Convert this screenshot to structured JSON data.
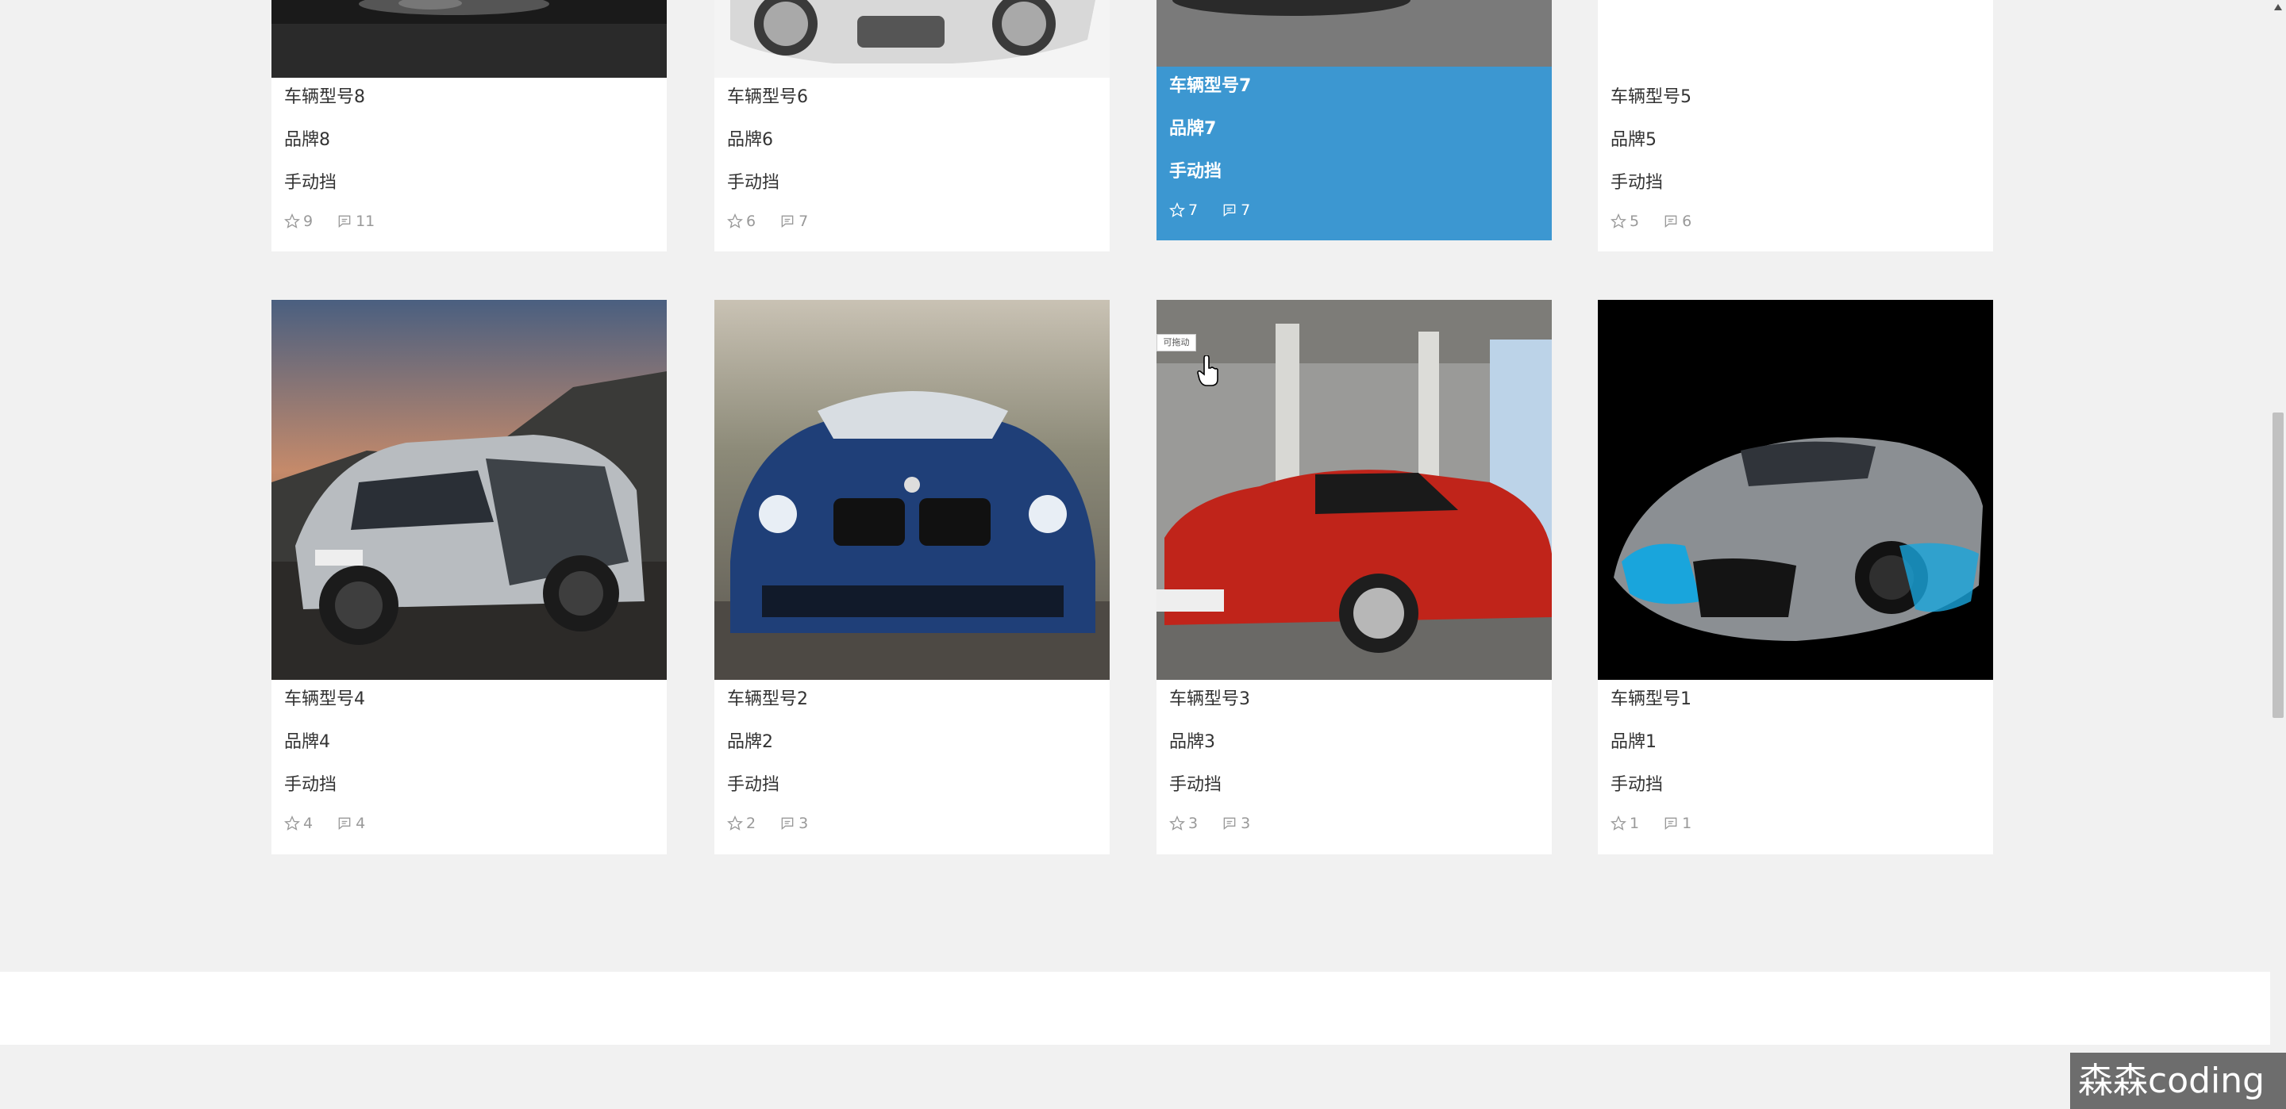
{
  "cards": [
    {
      "model": "车辆型号8",
      "brand": "品牌8",
      "transmission": "手动挡",
      "favorites": "9",
      "comments": "11",
      "active": false,
      "image": "silver-sports-car"
    },
    {
      "model": "车辆型号6",
      "brand": "品牌6",
      "transmission": "手动挡",
      "favorites": "6",
      "comments": "7",
      "active": false,
      "image": "white-audi-r8"
    },
    {
      "model": "车辆型号7",
      "brand": "品牌7",
      "transmission": "手动挡",
      "favorites": "7",
      "comments": "7",
      "active": true,
      "image": "gray-car-top"
    },
    {
      "model": "车辆型号5",
      "brand": "品牌5",
      "transmission": "手动挡",
      "favorites": "5",
      "comments": "6",
      "active": false,
      "image": "blank-white"
    },
    {
      "model": "车辆型号4",
      "brand": "品牌4",
      "transmission": "手动挡",
      "favorites": "4",
      "comments": "4",
      "active": false,
      "image": "vw-offroad-suv-sunset"
    },
    {
      "model": "车辆型号2",
      "brand": "品牌2",
      "transmission": "手动挡",
      "favorites": "2",
      "comments": "3",
      "active": false,
      "image": "blue-bmw-m3"
    },
    {
      "model": "车辆型号3",
      "brand": "品牌3",
      "transmission": "手动挡",
      "favorites": "3",
      "comments": "3",
      "active": false,
      "image": "red-infiniti-q50"
    },
    {
      "model": "车辆型号1",
      "brand": "品牌1",
      "transmission": "手动挡",
      "favorites": "1",
      "comments": "1",
      "active": false,
      "image": "gray-bugatti-divo"
    }
  ],
  "tooltip": "可拖动",
  "watermark": "森森coding",
  "icons": {
    "favorite": "star-icon",
    "comment": "comment-icon",
    "cursor": "hand-pointer-icon"
  },
  "colors": {
    "page_bg": "#f1f1f1",
    "card_bg": "#ffffff",
    "active_bg": "#3c97d1",
    "muted_text": "#999999"
  }
}
